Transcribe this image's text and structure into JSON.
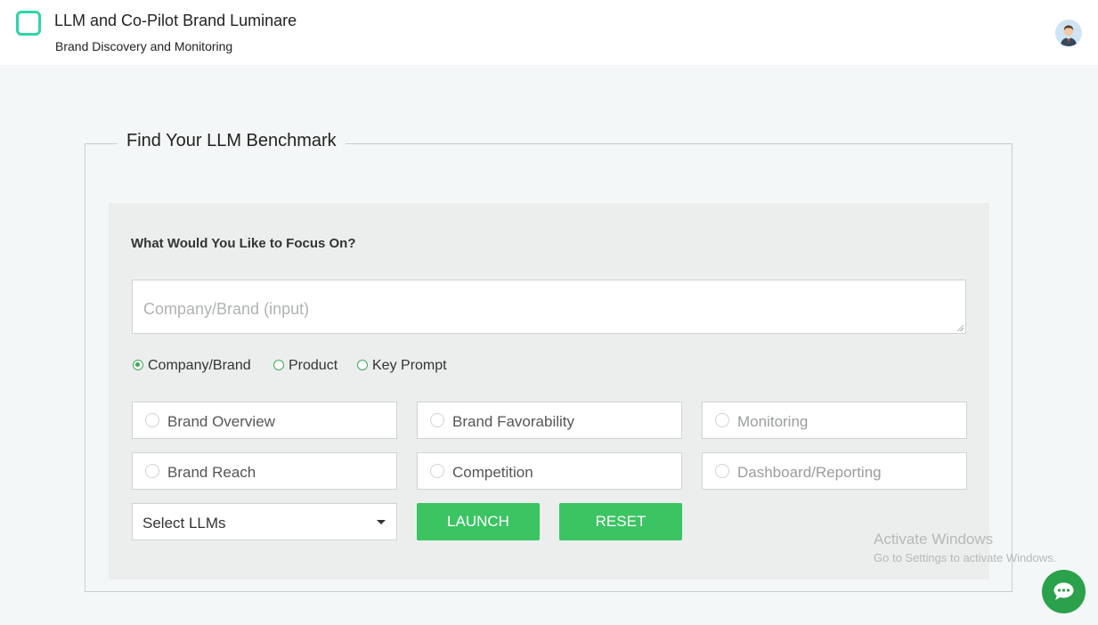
{
  "header": {
    "title": "LLM and Co-Pilot Brand Luminare",
    "subtitle": "Brand Discovery and Monitoring"
  },
  "form": {
    "legend": "Find Your LLM Benchmark",
    "focus_label": "What Would You Like to Focus On?",
    "input_placeholder": "Company/Brand (input)",
    "radio_options": [
      {
        "label": "Company/Brand",
        "checked": true
      },
      {
        "label": "Product",
        "checked": false
      },
      {
        "label": "Key Prompt",
        "checked": false
      }
    ],
    "options": [
      {
        "label": "Brand Overview",
        "enabled": true
      },
      {
        "label": "Brand Favorability",
        "enabled": true
      },
      {
        "label": "Monitoring",
        "enabled": false
      },
      {
        "label": "Brand Reach",
        "enabled": true
      },
      {
        "label": "Competition",
        "enabled": true
      },
      {
        "label": "Dashboard/Reporting",
        "enabled": false
      }
    ],
    "select_llms": "Select LLMs",
    "launch_label": "LAUNCH",
    "reset_label": "RESET"
  },
  "watermark": {
    "title": "Activate Windows",
    "subtitle": "Go to Settings to activate Windows."
  },
  "colors": {
    "accent_green": "#3cc463",
    "logo_teal": "#2fd4a7",
    "chat_green": "#2aa14a"
  },
  "icons": {
    "logo": "rounded-square-logo-icon",
    "avatar": "user-avatar-icon",
    "chat": "chat-bubble-icon",
    "dropdown": "chevron-down-icon"
  }
}
